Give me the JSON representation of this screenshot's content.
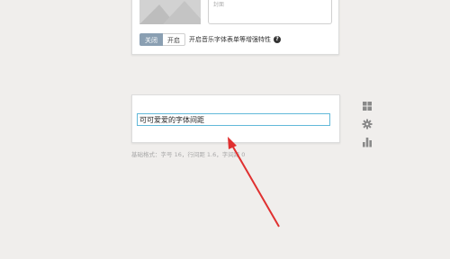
{
  "top_card": {
    "text_box_value": "封面",
    "toggle": {
      "off_label": "关闭",
      "on_label": "开启",
      "selected": "关闭"
    },
    "toggle_description": "开启音乐字体表单等增强特性",
    "help_icon_glyph": "?"
  },
  "bottom_card": {
    "input_value": "可可爱爱的字体间距"
  },
  "caption": "基础格式：字号 16，行间距 1.6，字间距 0",
  "side_toolbar": {
    "icons": [
      "grid-icon",
      "gear-icon",
      "bar-chart-icon"
    ]
  },
  "colors": {
    "background": "#f0eeec",
    "toggle_active": "#8a9fb2",
    "input_border": "#62b9d9",
    "arrow": "#e03030"
  }
}
